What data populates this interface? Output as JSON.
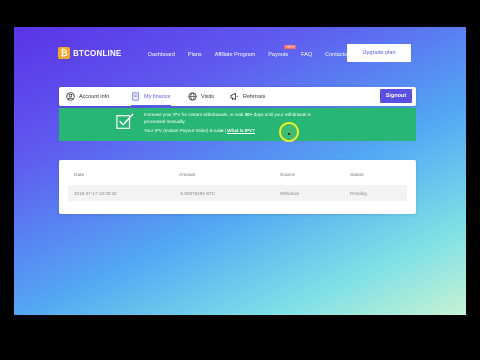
{
  "brand": {
    "name": "BTCONLINE",
    "logo_glyph": "₿",
    "accent": "#f6a623"
  },
  "nav": {
    "links": [
      "Dashboard",
      "Plans",
      "Affiliate Program",
      "Payouts",
      "FAQ",
      "Contacts"
    ],
    "payouts_badge": "NEW",
    "upgrade_label": "Upgrade plan"
  },
  "tabs": {
    "items": [
      {
        "label": "Account info",
        "icon": "user-circle-icon"
      },
      {
        "label": "My finance",
        "icon": "document-icon",
        "active": true
      },
      {
        "label": "Visits",
        "icon": "globe-icon"
      },
      {
        "label": "Referrals",
        "icon": "megaphone-icon"
      }
    ],
    "signout_label": "Signout"
  },
  "alert": {
    "line1_pre": "Increase your IPV for instant withdrawals, or wait ",
    "line1_bold": "30+",
    "line1_post": " days until your withdrawal is",
    "line2": "processed manually.",
    "line3_pre": "Your IPV (Instant Payout Value) is ",
    "line3_bold": "Low",
    "line3_sep": " | ",
    "line3_link": "What is IPV?",
    "color": "#27b673"
  },
  "table": {
    "headers": [
      "Date",
      "Amount",
      "Source",
      "Status"
    ],
    "rows": [
      {
        "date": "2018-07-17 18:35:32",
        "amount": "-0.00876469 BTC",
        "source": "Withdraw",
        "status": "Pending"
      }
    ]
  }
}
